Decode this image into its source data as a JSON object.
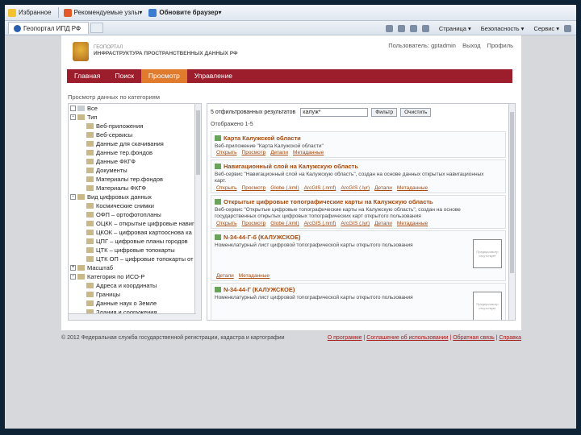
{
  "ie": {
    "favorites": "Избранное",
    "suggested": "Рекомендуемые узлы",
    "update": "Обновите браузер",
    "tab_title": "Геопортал ИПД РФ",
    "menu": [
      "Страница",
      "Безопасность",
      "Сервис"
    ]
  },
  "header": {
    "brand_line1": "ГЕОПОРТАЛ",
    "brand_line2": "ИНФРАСТРУКТУРА ПРОСТРАНСТВЕННЫХ ДАННЫХ РФ",
    "user": "Пользователь: gptadmin",
    "logout": "Выход",
    "profile": "Профиль"
  },
  "nav": [
    "Главная",
    "Поиск",
    "Просмотр",
    "Управление"
  ],
  "browse_title": "Просмотр данных по категориям",
  "tree": [
    {
      "label": "Все",
      "level": 0,
      "box": "",
      "folder": false
    },
    {
      "label": "Тип",
      "level": 0,
      "box": "−",
      "folder": true
    },
    {
      "label": "Веб-приложения",
      "level": 1
    },
    {
      "label": "Веб-сервисы",
      "level": 1
    },
    {
      "label": "Данные для скачивания",
      "level": 1
    },
    {
      "label": "Данные тер.фондов",
      "level": 1
    },
    {
      "label": "Данные ФКГФ",
      "level": 1
    },
    {
      "label": "Документы",
      "level": 1
    },
    {
      "label": "Материалы тер.фондов",
      "level": 1
    },
    {
      "label": "Материалы ФКГФ",
      "level": 1
    },
    {
      "label": "Вид цифровых данных",
      "level": 0,
      "box": "−",
      "folder": true
    },
    {
      "label": "Космические снимки",
      "level": 1
    },
    {
      "label": "ОФП – ортофотопланы",
      "level": 1
    },
    {
      "label": "ОЦКК – открытые цифровые навиг",
      "level": 1
    },
    {
      "label": "ЦКОК – цифровая картооснова ка",
      "level": 1
    },
    {
      "label": "ЦПГ – цифровые планы городов",
      "level": 1
    },
    {
      "label": "ЦТК – цифровые топокарты",
      "level": 1
    },
    {
      "label": "ЦТК ОП – цифровые топокарты от",
      "level": 1
    },
    {
      "label": "Масштаб",
      "level": 0,
      "box": "+",
      "folder": true
    },
    {
      "label": "Категория по ИСО-Р",
      "level": 0,
      "box": "−",
      "folder": true
    },
    {
      "label": "Адреса и координаты",
      "level": 1
    },
    {
      "label": "Границы",
      "level": 1
    },
    {
      "label": "Данные наук о Земле",
      "level": 1
    },
    {
      "label": "Здания и сооружения",
      "level": 1
    }
  ],
  "results": {
    "count_text": "5 отфильтрованных результатов",
    "filter_value": "калуж*",
    "filter_btn": "Фильтр",
    "clear_btn": "Очистить",
    "shown": "Отображено 1-5",
    "items": [
      {
        "title": "Карта Калужской области",
        "desc": "Веб-приложение \"Карта Калужской области\"",
        "links": [
          "Открыть",
          "Просмотр",
          "Детали",
          "Метаданные"
        ]
      },
      {
        "title": "Навигационный слой на Калужскую область",
        "desc": "Веб-сервис \"Навигационный слой на Калужскую область\", создан на основе данных открытых навигационных карт.",
        "links": [
          "Открыть",
          "Просмотр",
          "Globe (.kml)",
          "ArcGIS (.nmf)",
          "ArcGIS (.lyr)",
          "Детали",
          "Метаданные"
        ]
      },
      {
        "title": "Открытые цифровые топографические карты на Калужскую область",
        "desc": "Веб-сервис \"Открытые цифровые топографические карты на Калужскую область\", создан на основе государственных открытых цифровых топографических карт открытого пользования",
        "links": [
          "Открыть",
          "Просмотр",
          "Globe (.kml)",
          "ArcGIS (.nmf)",
          "ArcGIS (.lyr)",
          "Детали",
          "Метаданные"
        ]
      },
      {
        "title": "N-34-44-Г-б (КАЛУЖСКОЕ)",
        "desc": "Номенклатурный лист цифровой топографической карты открытого пользования",
        "links": [
          "Детали",
          "Метаданные"
        ],
        "thumb": "Предпросмотр отсутствует"
      },
      {
        "title": "N-34-44-Г (КАЛУЖСКОЕ)",
        "desc": "Номенклатурный лист цифровой топографической карты открытого пользования",
        "links": [],
        "thumb": "Предпросмотр отсутствует"
      }
    ]
  },
  "footer": {
    "copyright": "© 2012 Федеральная служба государственной регистрации, кадастра и картографии",
    "links": [
      "О программе",
      "Соглашение об использовании",
      "Обратная связь",
      "Справка"
    ]
  }
}
